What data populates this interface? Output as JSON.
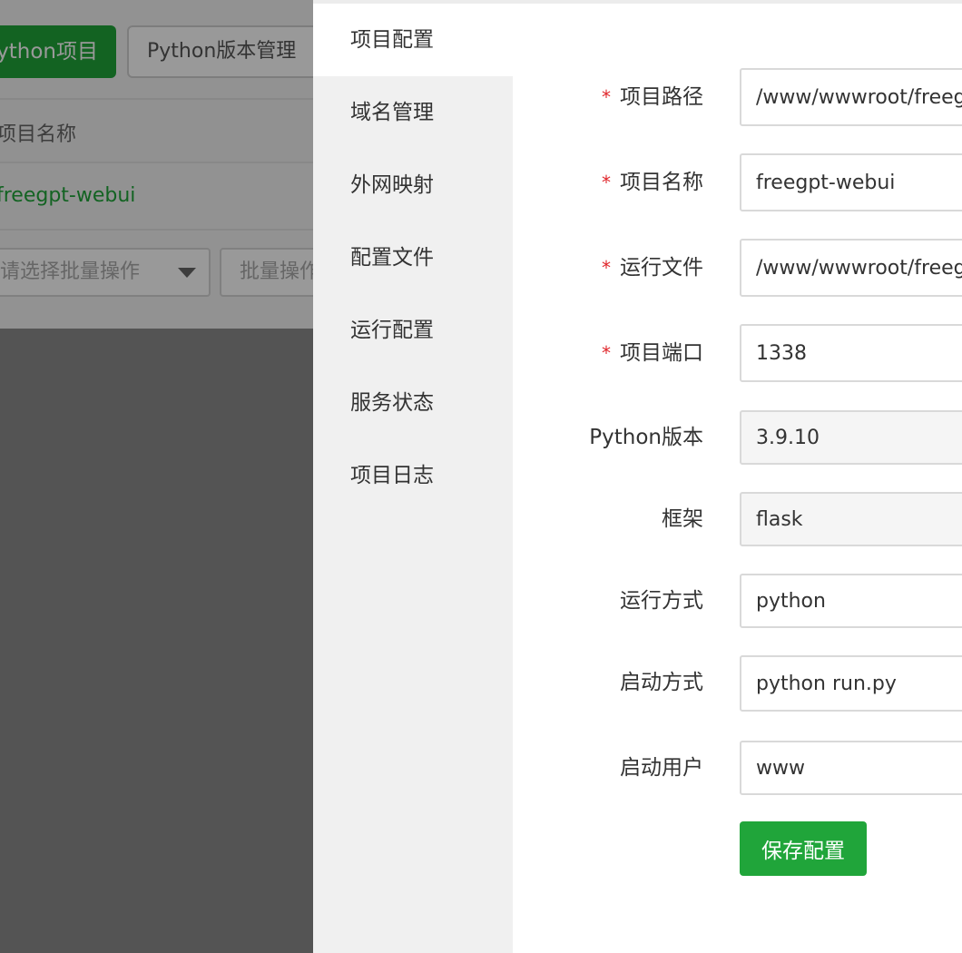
{
  "background": {
    "add_project_button": "ython项目",
    "version_manage_button": "Python版本管理",
    "table_header_name": "项目名称",
    "project_row_name": "freegpt-webui",
    "batch_select_placeholder": "请选择批量操作",
    "batch_button": "批量操作"
  },
  "sidebar": {
    "items": [
      {
        "label": "项目配置"
      },
      {
        "label": "域名管理"
      },
      {
        "label": "外网映射"
      },
      {
        "label": "配置文件"
      },
      {
        "label": "运行配置"
      },
      {
        "label": "服务状态"
      },
      {
        "label": "项目日志"
      }
    ]
  },
  "form": {
    "required_mark": "*",
    "fields": [
      {
        "label": "项目路径",
        "value": "/www/wwwroot/freegpt-webui"
      },
      {
        "label": "项目名称",
        "value": "freegpt-webui"
      },
      {
        "label": "运行文件",
        "value": "/www/wwwroot/freegpt-webui/run.py"
      },
      {
        "label": "项目端口",
        "value": "1338"
      },
      {
        "label": "Python版本",
        "value": "3.9.10"
      },
      {
        "label": "框架",
        "value": "flask"
      },
      {
        "label": "运行方式",
        "value": "python"
      },
      {
        "label": "启动方式",
        "value": "python run.py"
      },
      {
        "label": "启动用户",
        "value": "www"
      }
    ],
    "save_label": "保存配置"
  },
  "colors": {
    "accent": "#20a53a",
    "required": "#e0262b",
    "link_green": "#20a53a"
  }
}
